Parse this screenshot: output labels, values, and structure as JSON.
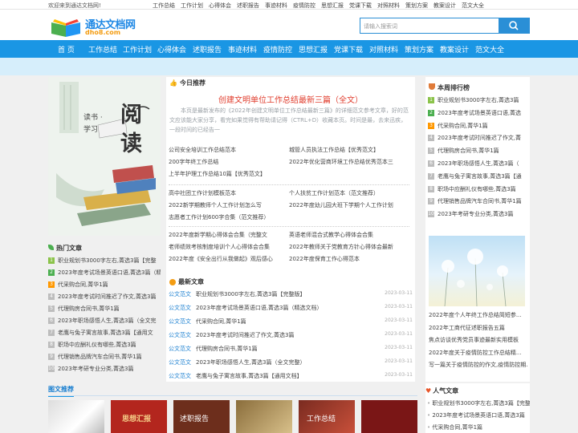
{
  "topbar": {
    "welcome": "欢迎来到通达文档网!",
    "links": [
      "工作总结",
      "工作计划",
      "心得体会",
      "述职报告",
      "事迹材料",
      "疫情防控",
      "思想汇报",
      "党课下载",
      "对照材料",
      "策划方案",
      "教案设计",
      "范文大全"
    ]
  },
  "logo": {
    "name": "通达文档网",
    "domain": "dho8.com"
  },
  "search": {
    "placeholder": "请输入搜索词"
  },
  "nav": [
    "首 页",
    "工作总结",
    "工作计划",
    "心得体会",
    "述职报告",
    "事迹材料",
    "疫情防控",
    "思想汇报",
    "党课下载",
    "对照材料",
    "策划方案",
    "教案设计",
    "范文大全"
  ],
  "cover": {
    "title": "阅读",
    "subtitle": "读书 · 学习"
  },
  "hot": {
    "title": "热门文章",
    "items": [
      "职业规划书3000字左右,菁选3篇【完整",
      "2023年度考试场景英语口语,菁选3篇（精",
      "代采购合同,菁华1篇",
      "2023年度考试时间推迟了作文,菁选3篇",
      "代理购房合同书,菁华1篇",
      "2023年职场感悟人生,菁选3篇（全文完",
      "老鹰与兔子寓言故事,菁选3篇【通用文",
      "职场中应酬礼仪有哪些,菁选3篇",
      "代理销售品牌汽车合同书,菁华1篇",
      "2023年考研专业分类,菁选3篇"
    ]
  },
  "today": {
    "title": "今日推荐",
    "headline": "创建文明单位工作总结最新三篇（全文）",
    "summary": "本页是最新发布的《2022年创建文明单位工作总结最新三篇》的详细范文参考文章，好的范文应该能大家分享，看完如果觉得有帮助请记得（CTRL+D）收藏本页。时间是最，去来迅疾，一段时间的已经告一",
    "groups": [
      [
        [
          "公司安全培训工作总结范本",
          "城管人员执法工作总结【优秀范文】"
        ],
        [
          "200字年终工作总结",
          "2022年优化营商环境工作总结优秀范本三"
        ],
        [
          "上半年护理工作总结10篇【优秀范文】",
          ""
        ]
      ],
      [
        [
          "高中社团工作计划模板范本",
          "个人扶贫工作计划范本（范文推荐）"
        ],
        [
          "2022新学期教师个人工作计划怎么写",
          "2022年度幼儿园大班下学期个人工作计划"
        ],
        [
          "志愿者工作计划600字合集（范文推荐）",
          ""
        ]
      ],
      [
        [
          "2022年度新学期心得体会合集（完整文",
          "英语老师混合式教学心得体会合集"
        ],
        [
          "老师绩效考核制度培训个人心得体会合集",
          "2022年教师关于党教育方针心得体会最新"
        ],
        [
          "2022年度《安全出行从我做起》观后感心",
          "2022年度保育工作心得范本"
        ]
      ]
    ]
  },
  "latest": {
    "title": "最新文章",
    "items": [
      {
        "cat": "公文范文",
        "text": "职业规划书3000字左右,菁选3篇【完整版】",
        "date": "2023-03-11"
      },
      {
        "cat": "公文范文",
        "text": "2023年度考试场景英语口语,菁选3篇（精选文档）",
        "date": "2023-03-11"
      },
      {
        "cat": "公文范文",
        "text": "代采购合同,菁华1篇",
        "date": "2023-03-11"
      },
      {
        "cat": "公文范文",
        "text": "2023年度考试时间推迟了作文,菁选3篇",
        "date": "2023-03-11"
      },
      {
        "cat": "公文范文",
        "text": "代理购房合同书,菁华1篇",
        "date": "2023-03-11"
      },
      {
        "cat": "公文范文",
        "text": "2023年职场感悟人生,菁选3篇（全文完整）",
        "date": "2023-03-11"
      },
      {
        "cat": "公文范文",
        "text": "老鹰与兔子寓言故事,菁选3篇【通用文档】",
        "date": "2023-03-11"
      }
    ]
  },
  "weekly": {
    "title": "本周排行榜",
    "items": [
      "职业规划书3000字左右,菁选3篇",
      "2023年度考试场景英语口语,菁选",
      "代采购合同,菁华1篇",
      "2023年度考试时间推迟了作文,菁",
      "代理购房合同书,菁华1篇",
      "2023年职场感悟人生,菁选3篇（",
      "老鹰与兔子寓言故事,菁选3篇【通",
      "职场中应酬礼仪有哪些,菁选3篇",
      "代理销售品牌汽车合同书,菁华1篇",
      "2023年考研专业分类,菁选3篇"
    ]
  },
  "rightlinks": [
    "2022年度个人年终工作总结简短参...",
    "2022年工商代征述职报告五篇",
    "焦点访谈优秀党员事迹最新实用模板",
    "2022年度关于疫情防控工作总结精...",
    "写一篇关于疫情防控的作文,疫情防控期..."
  ],
  "gallery": {
    "title": "图文推荐",
    "labels": [
      "",
      "思想汇报",
      "述职报告",
      "",
      "工作总结",
      ""
    ]
  },
  "popular": {
    "title": "人气文章",
    "items": [
      "职业规划书3000字左右,菁选3篇【完整",
      "2023年度考试场景英语口语,菁选3篇",
      "代采购合同,菁华1篇"
    ]
  },
  "colors": {
    "brand": "#1a96e4",
    "title_red": "#e03c2c",
    "cat_blue": "#1a7fd0"
  }
}
